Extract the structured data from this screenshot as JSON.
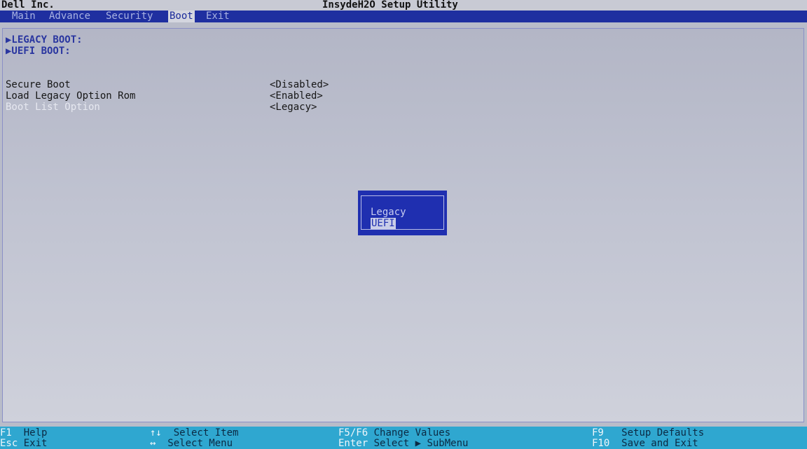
{
  "header": {
    "vendor": "Dell Inc.",
    "title": "InsydeH2O Setup Utility"
  },
  "menu": [
    {
      "label": "Main",
      "active": false
    },
    {
      "label": "Advance",
      "active": false
    },
    {
      "label": "Security",
      "active": false
    },
    {
      "label": "Boot",
      "active": true
    },
    {
      "label": "Exit",
      "active": false
    }
  ],
  "submenus": [
    {
      "label": "▶LEGACY BOOT:"
    },
    {
      "label": "▶UEFI BOOT:"
    }
  ],
  "settings": [
    {
      "label": "Secure Boot",
      "value": "<Disabled>"
    },
    {
      "label": "Load Legacy Option Rom",
      "value": "<Enabled>"
    },
    {
      "label": "Boot List Option",
      "value": "<Legacy>"
    }
  ],
  "popup": {
    "options": [
      "Legacy",
      "UEFI"
    ],
    "selected": "UEFI"
  },
  "hotkeys": {
    "f1_key": "F1",
    "f1_desc": "Help",
    "esc_key": "Esc",
    "esc_desc": "Exit",
    "updown_key": "↑↓",
    "updown_desc": "Select Item",
    "leftright_key": "↔",
    "leftright_desc": "Select Menu",
    "f5f6_key": "F5/F6",
    "f5f6_desc": "Change Values",
    "enter_key": "Enter",
    "enter_desc": "Select ▶ SubMenu",
    "f9_key": "F9",
    "f9_desc": "Setup Defaults",
    "f10_key": "F10",
    "f10_desc": "Save and Exit"
  },
  "colors": {
    "menubar": "#1f2fa0",
    "footer": "#2fa7d0",
    "popup": "#1f2fb0"
  }
}
